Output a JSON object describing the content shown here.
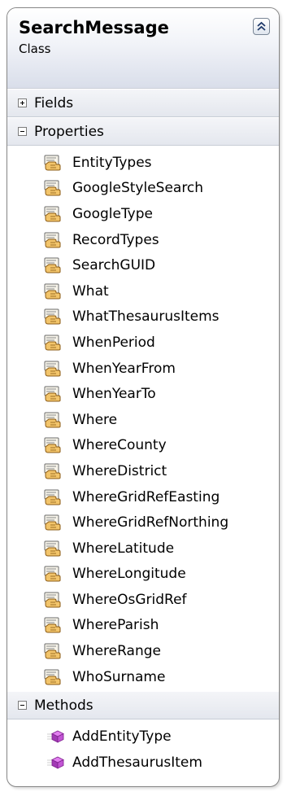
{
  "class": {
    "name": "SearchMessage",
    "kind": "Class"
  },
  "sections": {
    "fields": {
      "label": "Fields",
      "expanded": false
    },
    "properties": {
      "label": "Properties",
      "expanded": true,
      "items": [
        "EntityTypes",
        "GoogleStyleSearch",
        "GoogleType",
        "RecordTypes",
        "SearchGUID",
        "What",
        "WhatThesaurusItems",
        "WhenPeriod",
        "WhenYearFrom",
        "WhenYearTo",
        "Where",
        "WhereCounty",
        "WhereDistrict",
        "WhereGridRefEasting",
        "WhereGridRefNorthing",
        "WhereLatitude",
        "WhereLongitude",
        "WhereOsGridRef",
        "WhereParish",
        "WhereRange",
        "WhoSurname"
      ]
    },
    "methods": {
      "label": "Methods",
      "expanded": true,
      "items": [
        "AddEntityType",
        "AddThesaurusItem"
      ]
    }
  },
  "icons": {
    "collapse": "double-chevron-up-icon",
    "property": "property-hand-icon",
    "method": "method-cube-icon",
    "expand": "plus-box-icon",
    "collapse_section": "minus-box-icon"
  },
  "colors": {
    "border": "#868686",
    "header_gradient_end": "#d9deea",
    "section_gradient_end": "#e4e7ee",
    "method_icon": "#b845c8"
  }
}
